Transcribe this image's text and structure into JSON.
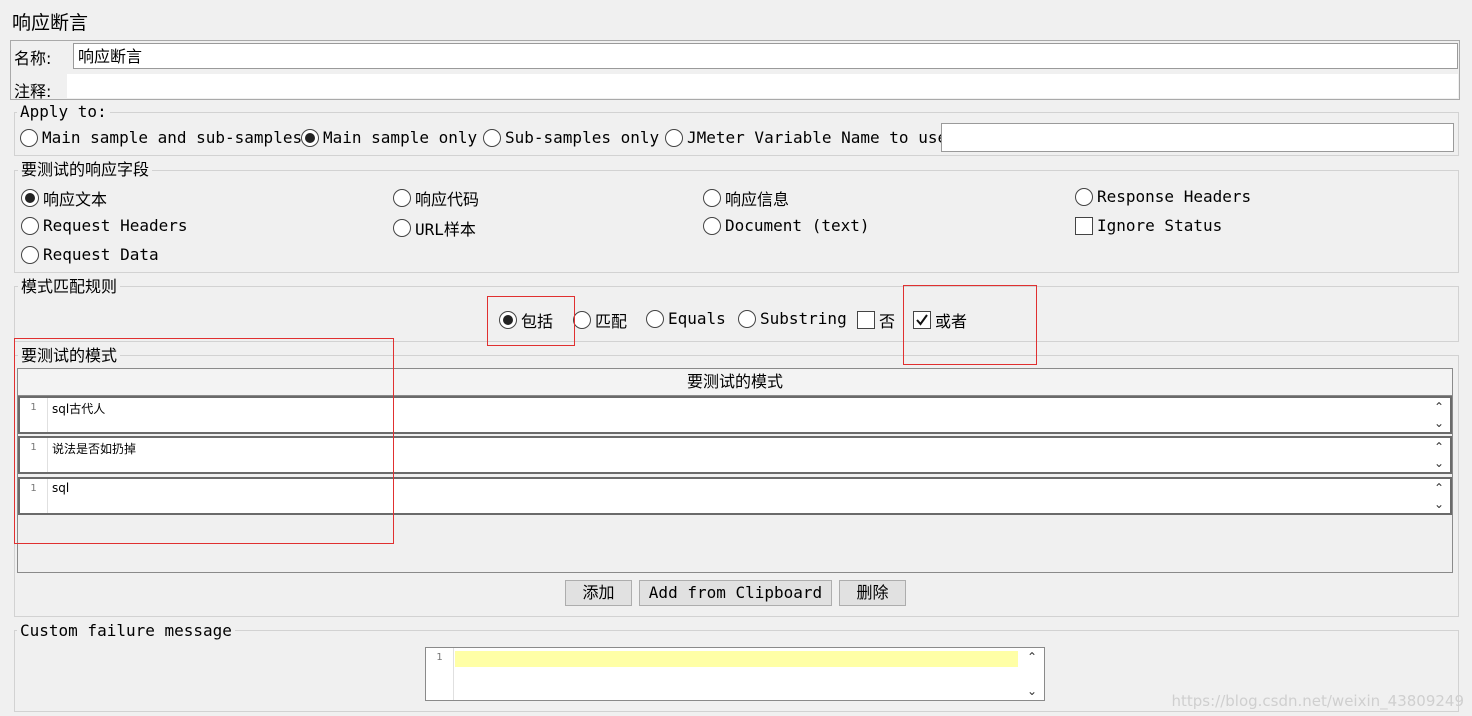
{
  "title": "响应断言",
  "name": {
    "label": "名称:",
    "value": "响应断言"
  },
  "comment": {
    "label": "注释:",
    "value": ""
  },
  "apply_to": {
    "legend": "Apply to:",
    "options": [
      "Main sample and sub-samples",
      "Main sample only",
      "Sub-samples only",
      "JMeter Variable Name to use"
    ],
    "selected": "Main sample only",
    "variable_value": ""
  },
  "fields": {
    "legend": "要测试的响应字段",
    "options": [
      "响应文本",
      "响应代码",
      "响应信息",
      "Response Headers",
      "Request Headers",
      "URL样本",
      "Document (text)",
      "Request Data"
    ],
    "selected": "响应文本",
    "ignore_status": {
      "label": "Ignore Status",
      "checked": false
    }
  },
  "rules": {
    "legend": "模式匹配规则",
    "options": [
      "包括",
      "匹配",
      "Equals",
      "Substring"
    ],
    "selected": "包括",
    "not": {
      "label": "否",
      "checked": false
    },
    "or": {
      "label": "或者",
      "checked": true
    }
  },
  "patterns": {
    "legend": "要测试的模式",
    "column_header": "要测试的模式",
    "rows": [
      {
        "line": "1",
        "text": "sql古代人"
      },
      {
        "line": "1",
        "text": "说法是否如扔掉"
      },
      {
        "line": "1",
        "text": "sql"
      }
    ]
  },
  "buttons": {
    "add": "添加",
    "add_clipboard": "Add from Clipboard",
    "delete": "删除"
  },
  "custom_failure": {
    "legend": "Custom failure message",
    "line": "1",
    "value": ""
  },
  "watermark": "https://blog.csdn.net/weixin_43809249",
  "icons": {
    "scroll_up": "chevron-up-icon",
    "scroll_down": "chevron-down-icon",
    "checked": "checkmark-icon"
  }
}
